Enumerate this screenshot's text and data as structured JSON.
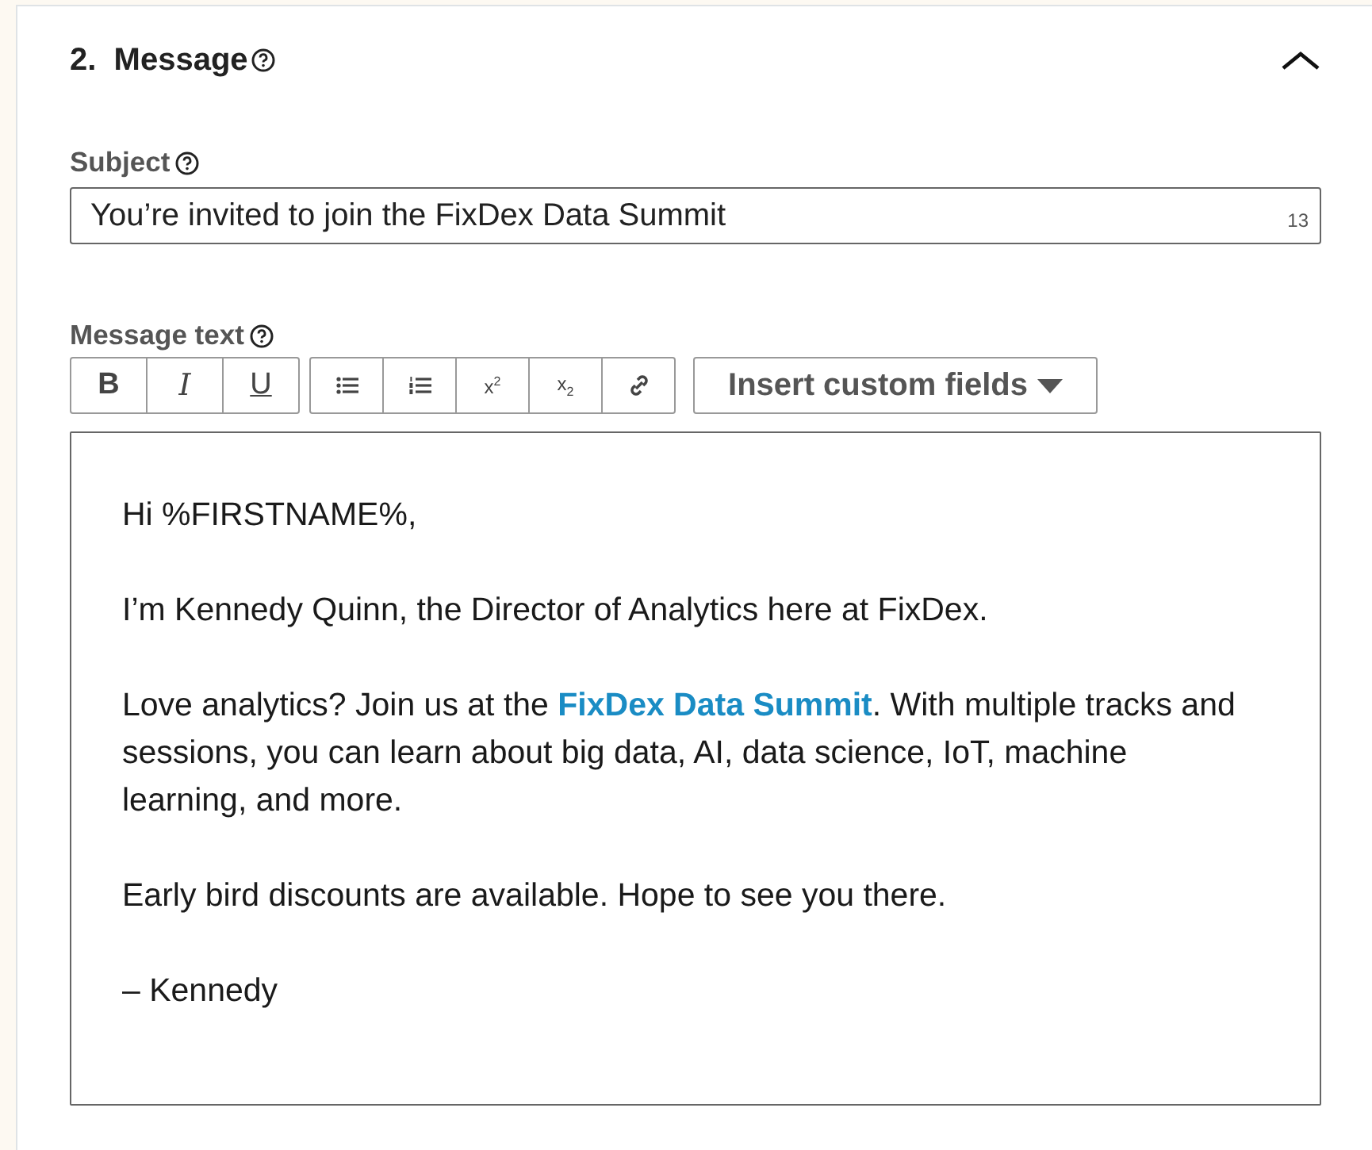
{
  "section": {
    "number": "2.",
    "title": "Message",
    "expanded": true
  },
  "subject": {
    "label": "Subject",
    "value": "You’re invited to join the FixDex Data Summit",
    "counter": "13"
  },
  "message": {
    "label": "Message text",
    "style_buttons": [
      "B",
      "I",
      "U"
    ],
    "script_buttons": [
      "x$^{2}$",
      "x$_{2}$"
    ],
    "insert_button": "Insert custom fields",
    "paragraphs": [
      {
        "parts": [
          {
            "text": "Hi %FIRSTNAME%,"
          }
        ]
      },
      {
        "parts": [
          {
            "text": "I’m Kennedy Quinn, the Director of Analytics here at FixDex."
          }
        ]
      },
      {
        "parts": [
          {
            "text": "Love analytics? Join us at the "
          },
          {
            "text": "FixDex Data Summit",
            "link": true
          },
          {
            "text": ". With multiple tracks and sessions, you can learn about big data, AI, data science, IoT, machine learning, and more."
          }
        ]
      },
      {
        "parts": [
          {
            "text": "Early bird discounts are available. Hope to see you there."
          }
        ]
      },
      {
        "parts": [
          {
            "text": "– Kennedy"
          }
        ]
      }
    ]
  }
}
